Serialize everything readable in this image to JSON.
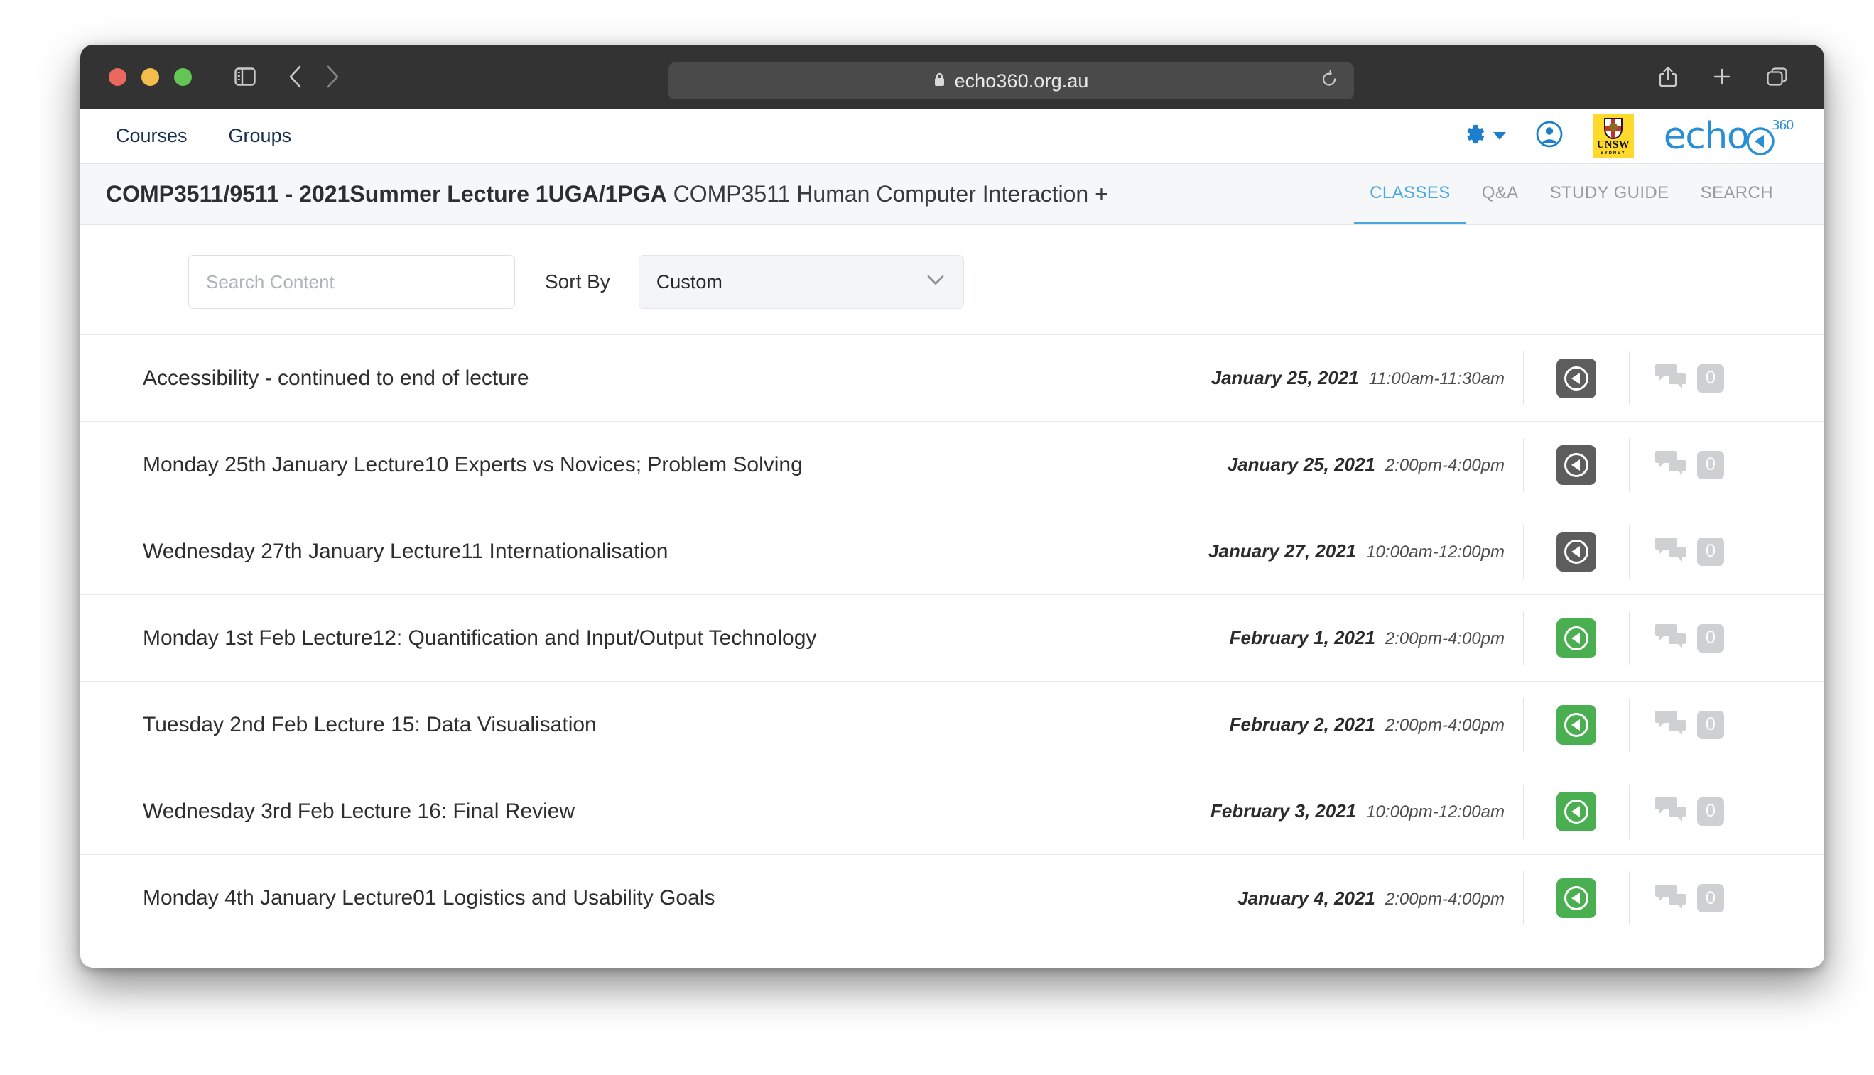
{
  "browser": {
    "url": "echo360.org.au",
    "lock_icon": "lock-icon",
    "sidebar_icon": "sidebar-toggle-icon",
    "back_icon": "back-chevron-icon",
    "forward_icon": "forward-chevron-icon",
    "reload_icon": "reload-icon",
    "share_icon": "share-icon",
    "newtab_icon": "plus-icon",
    "tabs_icon": "tab-overview-icon"
  },
  "appnav": {
    "links": [
      {
        "label": "Courses"
      },
      {
        "label": "Groups"
      }
    ],
    "settings_icon": "gear-icon",
    "account_icon": "user-account-icon",
    "institution_logo": {
      "name": "UNSW",
      "subtitle": "SYDNEY",
      "background": "#FFD92B"
    },
    "brand_logo": {
      "text": "echo",
      "superscript": "360"
    }
  },
  "course": {
    "title_bold": "COMP3511/9511 - 2021Summer Lecture 1UGA/1PGA",
    "title_regular": "COMP3511 Human Computer Interaction +",
    "tabs": [
      {
        "label": "CLASSES",
        "active": true
      },
      {
        "label": "Q&A",
        "active": false
      },
      {
        "label": "STUDY GUIDE",
        "active": false
      },
      {
        "label": "SEARCH",
        "active": false
      }
    ],
    "accent_color": "#4aa7e0"
  },
  "controls": {
    "search_placeholder": "Search Content",
    "search_value": "",
    "sort_label": "Sort By",
    "sort_value": "Custom",
    "chevron_icon": "chevron-down-icon"
  },
  "classes": [
    {
      "title": "Accessibility - continued to end of lecture",
      "date": "January 25, 2021",
      "time": "11:00am-11:30am",
      "status": "gray",
      "comments": "0"
    },
    {
      "title": "Monday 25th January Lecture10 Experts vs Novices; Problem Solving",
      "date": "January 25, 2021",
      "time": "2:00pm-4:00pm",
      "status": "gray",
      "comments": "0"
    },
    {
      "title": "Wednesday 27th January Lecture11 Internationalisation",
      "date": "January 27, 2021",
      "time": "10:00am-12:00pm",
      "status": "gray",
      "comments": "0"
    },
    {
      "title": "Monday 1st Feb Lecture12: Quantification and Input/Output Technology",
      "date": "February 1, 2021",
      "time": "2:00pm-4:00pm",
      "status": "green",
      "comments": "0"
    },
    {
      "title": "Tuesday 2nd Feb Lecture 15: Data Visualisation",
      "date": "February 2, 2021",
      "time": "2:00pm-4:00pm",
      "status": "green",
      "comments": "0"
    },
    {
      "title": "Wednesday 3rd Feb Lecture 16: Final Review",
      "date": "February 3, 2021",
      "time": "10:00pm-12:00am",
      "status": "green",
      "comments": "0"
    },
    {
      "title": "Monday 4th January Lecture01 Logistics and Usability Goals",
      "date": "January 4, 2021",
      "time": "2:00pm-4:00pm",
      "status": "green",
      "comments": "0"
    }
  ],
  "colors": {
    "status_gray": "#5d5d5d",
    "status_green": "#4aaf50",
    "tab_active": "#4aa7e0",
    "brand_blue": "#2a8fd4"
  }
}
